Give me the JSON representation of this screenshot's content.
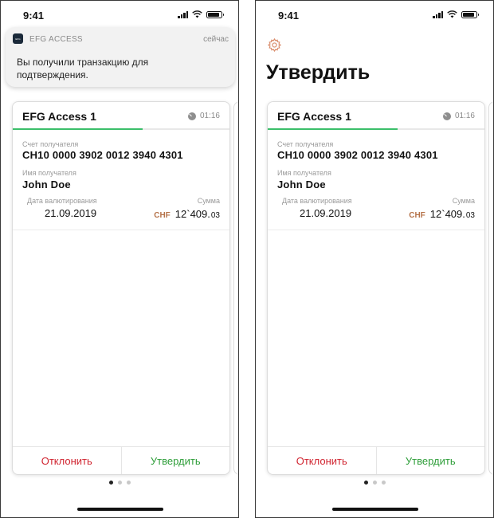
{
  "status_bar": {
    "time": "9:41"
  },
  "notification": {
    "app_name": "EFG ACCESS",
    "app_icon_text": "EFG",
    "time": "сейчас",
    "message": "Вы получили транзакцию для подтверждения."
  },
  "header": {
    "title": "Утвердить"
  },
  "card": {
    "title": "EFG Access 1",
    "timer": "01:16",
    "progress": 0.6,
    "account_label": "Счет получателя",
    "account_value": "CH10 0000 3902 0012 3940 4301",
    "recipient_label": "Имя получателя",
    "recipient_value": "John Doe",
    "value_date_label": "Дата валютирования",
    "value_date": "21.09.2019",
    "sum_label": "Сумма",
    "currency": "CHF",
    "amount_int": "12`409.",
    "amount_dec": "03",
    "reject_label": "Отклонить",
    "approve_label": "Утвердить"
  },
  "pagination": {
    "pages": 3,
    "current": 1
  },
  "colors": {
    "progress": "#3bbf6a",
    "reject": "#d0232f",
    "approve": "#2f9e3a",
    "currency": "#b5734a",
    "gear": "#d98b6a"
  },
  "icons": [
    "timer-icon",
    "gear-icon",
    "wifi-icon",
    "signal-icon",
    "battery-icon"
  ]
}
